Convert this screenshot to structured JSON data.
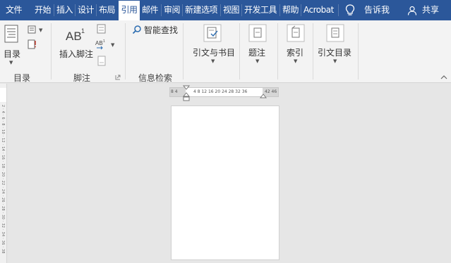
{
  "tabs": [
    {
      "label": "文件",
      "active": false
    },
    {
      "label": "开始",
      "active": false
    },
    {
      "label": "插入",
      "active": false
    },
    {
      "label": "设计",
      "active": false
    },
    {
      "label": "布局",
      "active": false
    },
    {
      "label": "引用",
      "active": true
    },
    {
      "label": "邮件",
      "active": false
    },
    {
      "label": "审阅",
      "active": false
    },
    {
      "label": "新建选项",
      "active": false
    },
    {
      "label": "视图",
      "active": false
    },
    {
      "label": "开发工具",
      "active": false
    },
    {
      "label": "帮助",
      "active": false
    },
    {
      "label": "Acrobat",
      "active": false
    }
  ],
  "tell_me": "告诉我",
  "share": "共享",
  "ribbon": {
    "toc_button": "目录",
    "toc_group": "目录",
    "insert_footnote": "插入脚注",
    "footnote_group": "脚注",
    "smart_lookup": "智能查找",
    "research_group": "信息检索",
    "citations": "引文与书目",
    "captions": "题注",
    "index": "索引",
    "table_of_authorities": "引文目录"
  },
  "ruler": {
    "left_numbers": "8  4",
    "numbers": "4  8  12 16 20 24 28 32 36",
    "right_numbers": "42 46"
  },
  "vruler_text": "2 · 4 · 6 · 8 · 10 · 12 · 14 · 16 · 18 · 20 · 22 · 24 · 26 · 28 · 30 · 32 · 34 · 36 · 38"
}
